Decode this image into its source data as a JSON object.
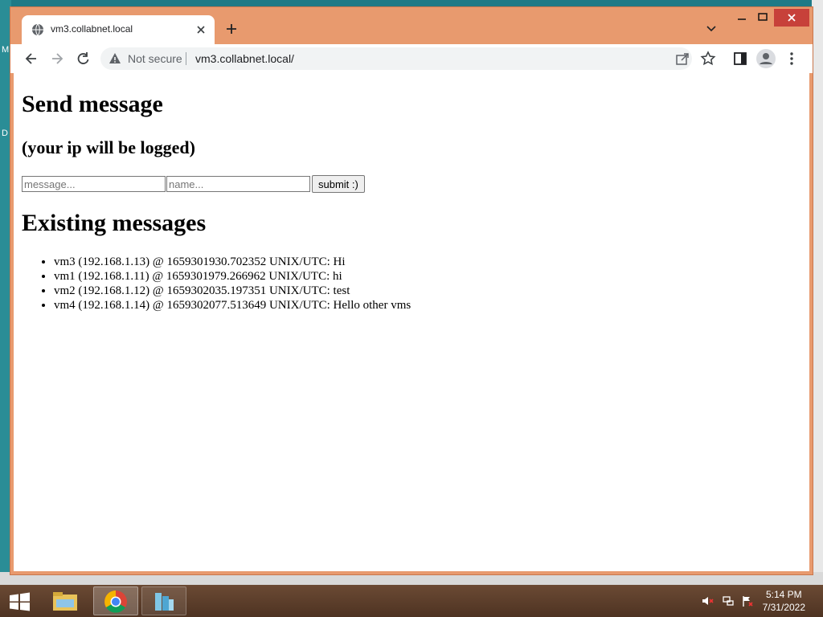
{
  "browser": {
    "tab_title": "vm3.collabnet.local",
    "omnibox": {
      "security_label": "Not secure",
      "url": "vm3.collabnet.local/"
    }
  },
  "page": {
    "heading": "Send message",
    "subheading": "(your ip will be logged)",
    "form": {
      "message_placeholder": "message...",
      "name_placeholder": "name...",
      "submit_label": "submit :)"
    },
    "messages_heading": "Existing messages",
    "messages": [
      "vm3 (192.168.1.13) @ 1659301930.702352 UNIX/UTC: Hi",
      "vm1 (192.168.1.11) @ 1659301979.266962 UNIX/UTC: hi",
      "vm2 (192.168.1.12) @ 1659302035.197351 UNIX/UTC: test",
      "vm4 (192.168.1.14) @ 1659302077.513649 UNIX/UTC: Hello other vms"
    ]
  },
  "taskbar": {
    "time": "5:14 PM",
    "date": "7/31/2022"
  },
  "desktop": {
    "icon_labels": [
      "M",
      "D"
    ]
  },
  "colors": {
    "chrome_frame": "#e89a6e",
    "close_button": "#c7413a",
    "taskbar": "#5a3b28"
  },
  "icons": [
    "globe-icon",
    "close-icon",
    "plus-icon",
    "chevron-down-icon",
    "back-arrow-icon",
    "forward-arrow-icon",
    "reload-icon",
    "warning-icon",
    "share-icon",
    "star-icon",
    "sidepanel-icon",
    "profile-icon",
    "kebab-menu-icon",
    "windows-start-icon",
    "file-explorer-icon",
    "chrome-icon",
    "network-app-icon",
    "speaker-muted-icon",
    "network-icon",
    "action-center-flag-icon"
  ]
}
